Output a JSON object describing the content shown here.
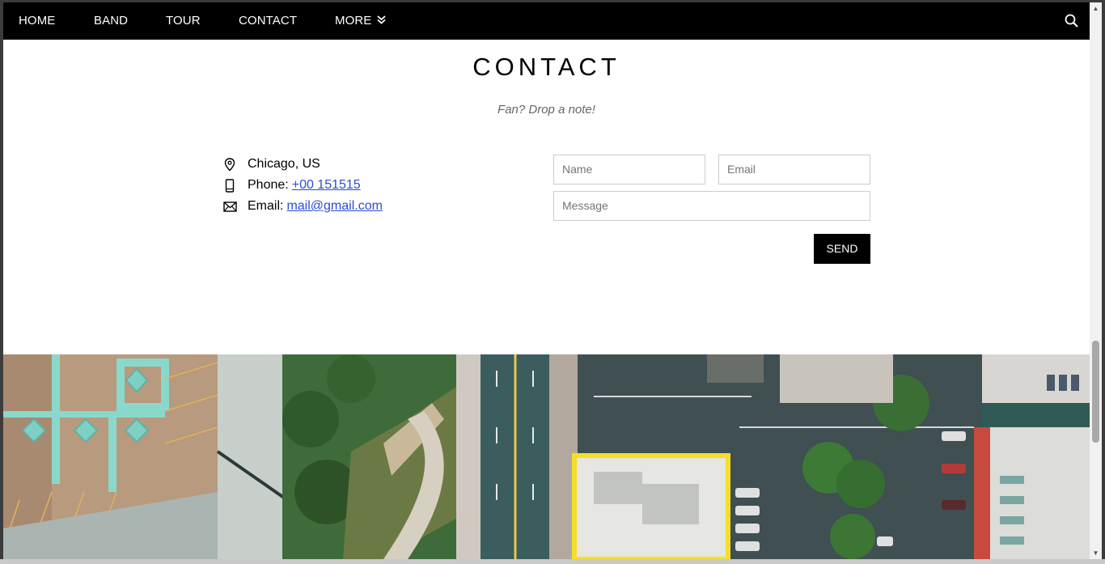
{
  "nav": {
    "items": [
      {
        "label": "HOME"
      },
      {
        "label": "BAND"
      },
      {
        "label": "TOUR"
      },
      {
        "label": "CONTACT"
      },
      {
        "label": "MORE"
      }
    ],
    "search_icon": "search-icon",
    "more_icon": "double-chevron-down-icon"
  },
  "contact": {
    "title": "CONTACT",
    "tagline": "Fan? Drop a note!",
    "location": {
      "icon": "map-pin-icon",
      "text": "Chicago, US"
    },
    "phone": {
      "icon": "phone-icon",
      "label": "Phone:",
      "value": "+00 151515"
    },
    "email": {
      "icon": "envelope-icon",
      "label": "Email:",
      "value": "mail@gmail.com"
    }
  },
  "form": {
    "name_placeholder": "Name",
    "email_placeholder": "Email",
    "message_placeholder": "Message",
    "send_label": "SEND"
  },
  "colors": {
    "navbar": "#000000",
    "link": "#2a4bd7",
    "button": "#000000"
  }
}
